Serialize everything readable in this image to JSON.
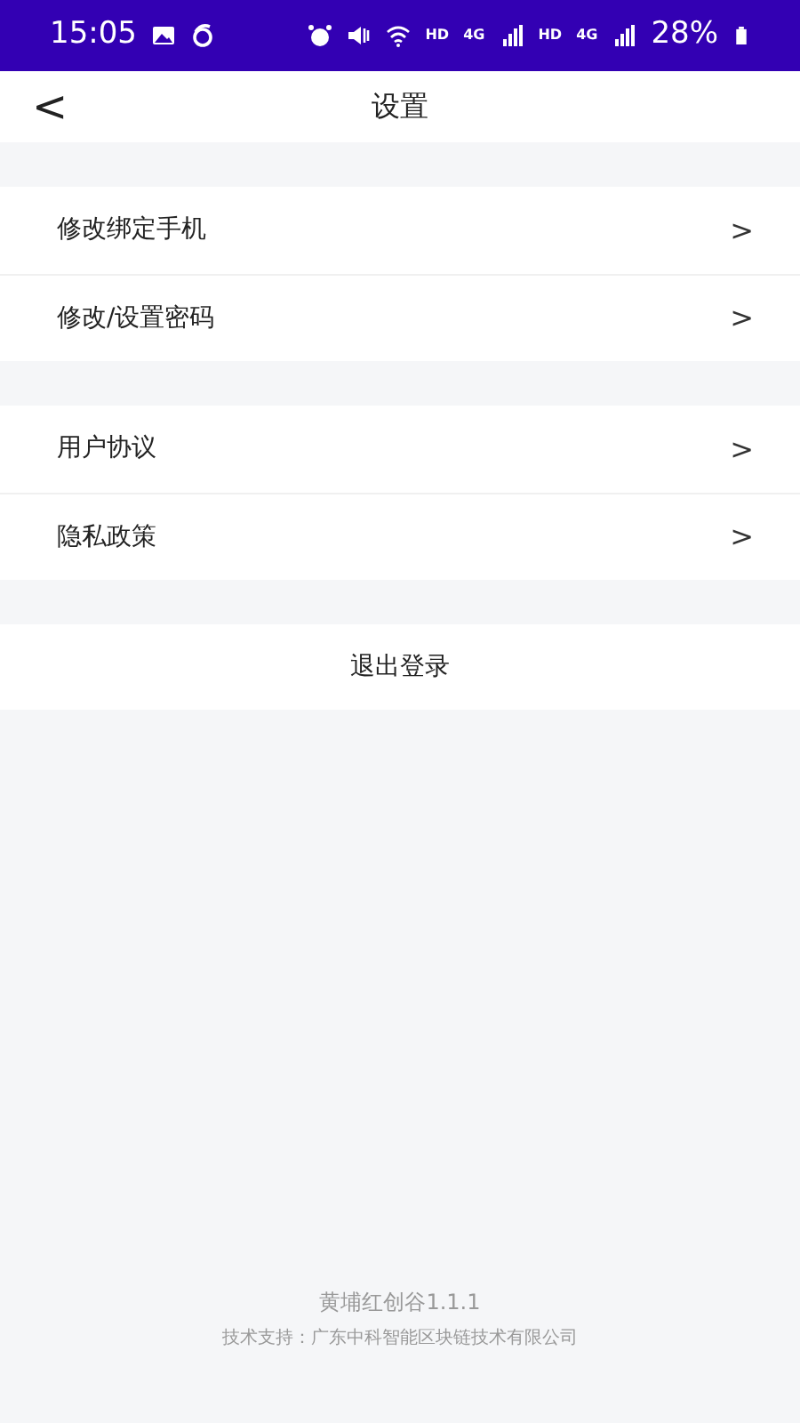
{
  "status_bar": {
    "time": "15:05",
    "indicators": [
      "HD",
      "4G",
      "HD",
      "4G"
    ],
    "battery": "28%"
  },
  "header": {
    "back": "<",
    "title": "设置"
  },
  "groups": [
    {
      "items": [
        {
          "label": "修改绑定手机",
          "chevron": ">"
        },
        {
          "label": "修改/设置密码",
          "chevron": ">"
        }
      ]
    },
    {
      "items": [
        {
          "label": "用户协议",
          "chevron": ">"
        },
        {
          "label": "隐私政策",
          "chevron": ">"
        }
      ]
    }
  ],
  "logout": "退出登录",
  "footer": {
    "version": "黄埔红创谷1.1.1",
    "support": "技术支持：广东中科智能区块链技术有限公司"
  }
}
